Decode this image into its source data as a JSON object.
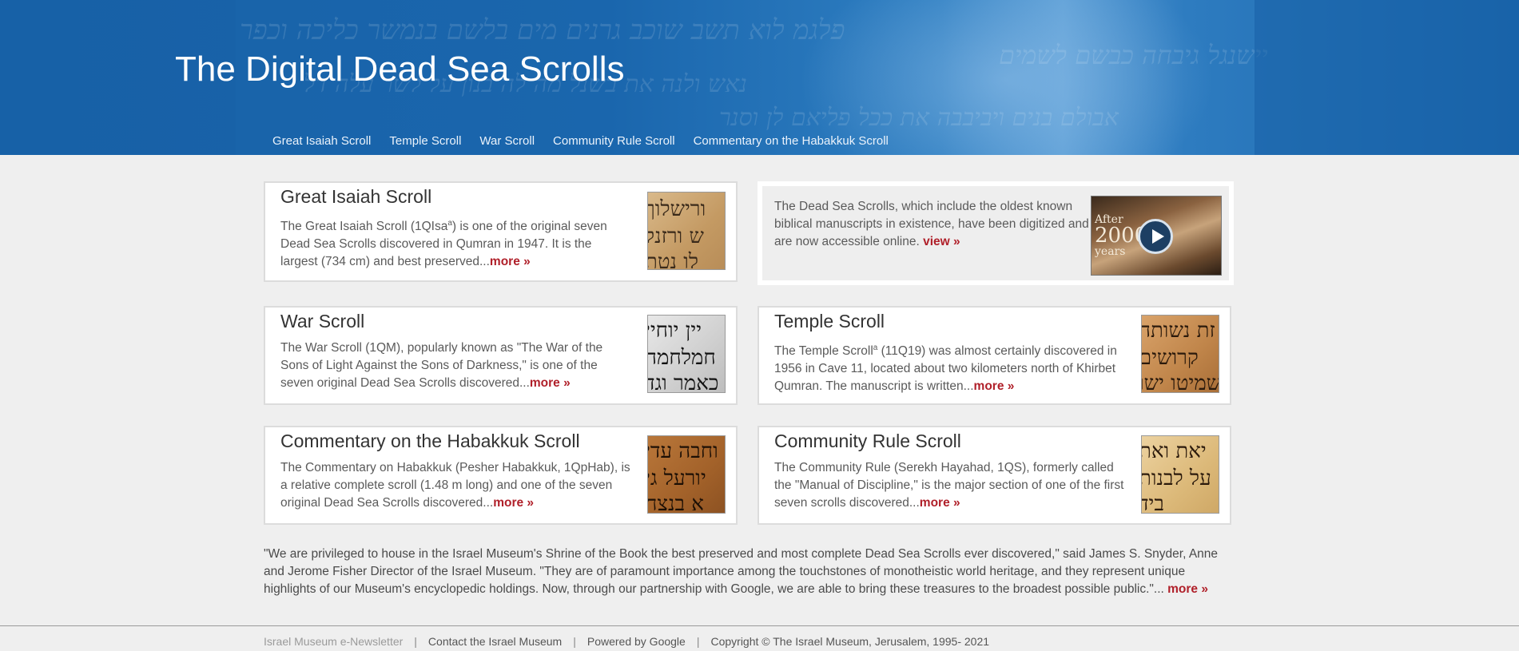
{
  "header": {
    "title": "The Digital Dead Sea Scrolls",
    "nav": [
      "Great Isaiah Scroll",
      "Temple Scroll",
      "War Scroll",
      "Community Rule Scroll",
      "Commentary on the Habakkuk Scroll"
    ]
  },
  "cards": {
    "isaiah": {
      "title": "Great Isaiah Scroll",
      "text_a": "The Great Isaiah Scroll (1QIsa",
      "sup": "a",
      "text_b": ") is one of the original seven Dead Sea Scrolls discovered in Qumran in 1947. It is the largest (734 cm) and best preserved...",
      "more": "more »",
      "thumb_icon": "isaiah-scroll-thumbnail"
    },
    "war": {
      "title": "War Scroll",
      "text": "The War Scroll (1QM), popularly known as \"The War of the Sons of Light Against the Sons of Darkness,\" is one of the seven original Dead Sea Scrolls discovered...",
      "more": "more »",
      "thumb_icon": "war-scroll-thumbnail"
    },
    "temple": {
      "title": "Temple Scroll",
      "text_a": "The Temple Scroll",
      "sup": "a",
      "text_b": " (11Q19) was almost certainly discovered in 1956 in Cave 11, located about two kilometers north of Khirbet Qumran. The manuscript is written...",
      "more": "more »",
      "thumb_icon": "temple-scroll-thumbnail"
    },
    "habakkuk": {
      "title": "Commentary on the Habakkuk Scroll",
      "text": "The Commentary on Habakkuk (Pesher Habakkuk, 1QpHab), is a relative complete scroll (1.48 m long) and one of the seven original Dead Sea Scrolls discovered...",
      "more": "more »",
      "thumb_icon": "habakkuk-scroll-thumbnail"
    },
    "community": {
      "title": "Community Rule Scroll",
      "text": "The Community Rule (Serekh Hayahad, 1QS), formerly called the \"Manual of Discipline,\" is the major section of one of the first seven scrolls discovered...",
      "more": "more »",
      "thumb_icon": "community-rule-scroll-thumbnail"
    }
  },
  "video": {
    "text": "The Dead Sea Scrolls, which include the oldest known biblical manuscripts in existence, have been digitized and are now accessible online. ",
    "link": "view »",
    "thumb_text_top": "After",
    "thumb_text_big": "2000",
    "thumb_text_bottom": "years"
  },
  "quote": {
    "text": "\"We are privileged to house in the Israel Museum's Shrine of the Book the best preserved and most complete Dead Sea Scrolls ever discovered,\" said James S. Snyder, Anne and Jerome Fisher Director of the Israel Museum. \"They are of paramount importance among the touchstones of monotheistic world heritage, and they represent unique highlights of our Museum's encyclopedic holdings. Now, through our partnership with Google, we are able to bring these treasures to the broadest possible public.\"... ",
    "more": "more »"
  },
  "footer": {
    "links": [
      "Israel Museum e-Newsletter",
      "Contact the Israel Museum",
      "Powered by Google",
      "Copyright © The Israel Museum, Jerusalem, 1995- 2021"
    ],
    "separator": "|"
  },
  "colors": {
    "header_blue": "#1a66ad",
    "link_red": "#b0202a",
    "page_bg": "#efefef"
  }
}
